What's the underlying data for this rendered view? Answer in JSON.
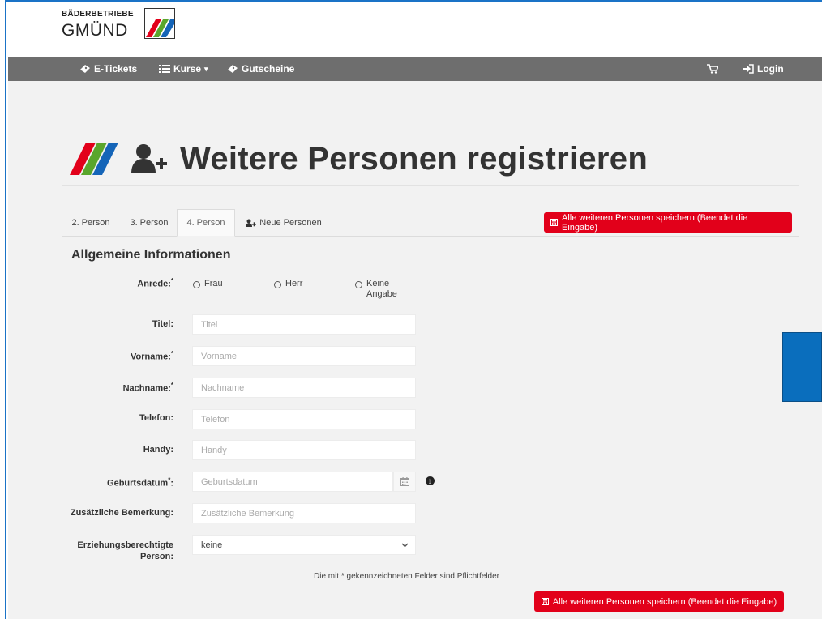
{
  "brand": {
    "line1": "BÄDERBETRIEBE",
    "line2": "GMÜND",
    "colors": {
      "red": "#e2001a",
      "green": "#5aa62c",
      "blue": "#1565b8"
    }
  },
  "nav": {
    "left": [
      {
        "label": "E-Tickets",
        "icon": "ticket-icon"
      },
      {
        "label": "Kurse",
        "icon": "list-icon",
        "caret": "▾"
      },
      {
        "label": "Gutscheine",
        "icon": "ticket-icon"
      }
    ],
    "cart_icon": "cart-icon",
    "login": {
      "label": "Login",
      "icon": "sign-in-icon"
    }
  },
  "page": {
    "title": "Weitere Personen registrieren",
    "icon": "user-plus-icon"
  },
  "tabs": [
    {
      "label": "2. Person",
      "active": false
    },
    {
      "label": "3. Person",
      "active": false
    },
    {
      "label": "4. Person",
      "active": true
    },
    {
      "label": "Neue Personen",
      "active": false,
      "icon": "user-plus-icon"
    }
  ],
  "save_button": {
    "label": "Alle weiteren Personen speichern (Beendet die Eingabe)",
    "icon": "floppy-disk-icon"
  },
  "section_title": "Allgemeine Informationen",
  "form": {
    "anrede": {
      "label": "Anrede:",
      "required": "*",
      "options": [
        "Frau",
        "Herr",
        "Keine",
        "Angabe"
      ]
    },
    "fields": [
      {
        "label": "Titel:",
        "placeholder": "Titel"
      },
      {
        "label": "Vorname:",
        "required": "*",
        "placeholder": "Vorname"
      },
      {
        "label": "Nachname:",
        "required": "*",
        "placeholder": "Nachname"
      },
      {
        "label": "Telefon:",
        "placeholder": "Telefon"
      },
      {
        "label": "Handy:",
        "placeholder": "Handy"
      },
      {
        "label": "Geburtsdatum",
        "required": "*",
        "suffix": ":",
        "placeholder": "Geburtsdatum"
      },
      {
        "label": "Zusätzliche Bemerkung:",
        "placeholder": "Zusätzliche Bemerkung"
      }
    ],
    "guardian": {
      "label_line1": "Erziehungsberechtigte",
      "label_line2": "Person:",
      "selected": "keine"
    }
  },
  "footnote": "Die mit * gekennzeichneten Felder sind Pflichtfelder"
}
